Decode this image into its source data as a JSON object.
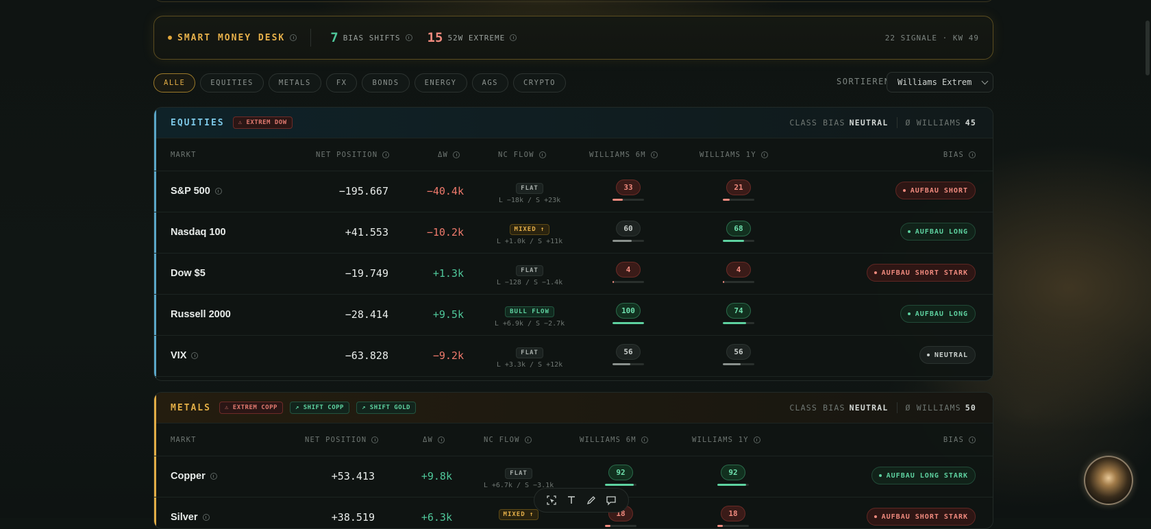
{
  "header": {
    "title": "SMART MONEY DESK",
    "stats": [
      {
        "value": "7",
        "label": "BIAS SHIFTS",
        "color": "#4fc79a"
      },
      {
        "value": "15",
        "label": "52W EXTREME",
        "color": "#f08a7e"
      }
    ],
    "meta": "22 SIGNALE · KW 49"
  },
  "filters": [
    "ALLE",
    "EQUITIES",
    "METALS",
    "FX",
    "BONDS",
    "ENERGY",
    "AGS",
    "CRYPTO"
  ],
  "active_filter": "ALLE",
  "sort": {
    "label": "SORTIEREN",
    "value": "Williams Extrem"
  },
  "columns": {
    "market": "MARKT",
    "net": "NET POSITION",
    "dw": "ΔW",
    "flow": "NC FLOW",
    "w6m": "WILLIAMS 6M",
    "w1y": "WILLIAMS 1Y",
    "bias": "BIAS"
  },
  "sections": [
    {
      "title": "EQUITIES",
      "accent": "#5aa6c8",
      "tags": [
        {
          "text": "⚠ EXTREM DOW",
          "kind": "red"
        }
      ],
      "class_bias_label": "CLASS BIAS",
      "class_bias": "NEUTRAL",
      "williams_label": "Ø WILLIAMS",
      "williams": "45",
      "rows": [
        {
          "name": "S&P 500",
          "info": true,
          "net": "−195.667",
          "dw": "−40.4k",
          "dw_dir": "neg",
          "flow": "FLAT",
          "flow_kind": "flat",
          "flow_sub": "L −18k / S +23k",
          "w6m": "33",
          "w6m_kind": "red",
          "w6m_pct": 33,
          "w1y": "21",
          "w1y_kind": "red",
          "w1y_pct": 21,
          "bias": "AUFBAU SHORT",
          "bias_kind": "short"
        },
        {
          "name": "Nasdaq 100",
          "info": false,
          "net": "+41.553",
          "dw": "−10.2k",
          "dw_dir": "neg",
          "flow": "MIXED ↑",
          "flow_kind": "mixed",
          "flow_sub": "L +1.0k / S +11k",
          "w6m": "60",
          "w6m_kind": "gray",
          "w6m_pct": 60,
          "w1y": "68",
          "w1y_kind": "green",
          "w1y_pct": 68,
          "bias": "AUFBAU LONG",
          "bias_kind": "long"
        },
        {
          "name": "Dow $5",
          "info": false,
          "net": "−19.749",
          "dw": "+1.3k",
          "dw_dir": "pos",
          "flow": "FLAT",
          "flow_kind": "flat",
          "flow_sub": "L −128 / S −1.4k",
          "w6m": "4",
          "w6m_kind": "red",
          "w6m_pct": 4,
          "w1y": "4",
          "w1y_kind": "red",
          "w1y_pct": 4,
          "bias": "AUFBAU SHORT STARK",
          "bias_kind": "short"
        },
        {
          "name": "Russell 2000",
          "info": false,
          "net": "−28.414",
          "dw": "+9.5k",
          "dw_dir": "pos",
          "flow": "BULL FLOW",
          "flow_kind": "bull",
          "flow_sub": "L +6.9k / S −2.7k",
          "w6m": "100",
          "w6m_kind": "green",
          "w6m_pct": 100,
          "w1y": "74",
          "w1y_kind": "green",
          "w1y_pct": 74,
          "bias": "AUFBAU LONG",
          "bias_kind": "long"
        },
        {
          "name": "VIX",
          "info": true,
          "net": "−63.828",
          "dw": "−9.2k",
          "dw_dir": "neg",
          "flow": "FLAT",
          "flow_kind": "flat",
          "flow_sub": "L +3.3k / S +12k",
          "w6m": "56",
          "w6m_kind": "gray",
          "w6m_pct": 56,
          "w1y": "56",
          "w1y_kind": "gray",
          "w1y_pct": 56,
          "bias": "NEUTRAL",
          "bias_kind": "neutral"
        }
      ]
    },
    {
      "title": "METALS",
      "accent": "#e2ad45",
      "tags": [
        {
          "text": "⚠ EXTREM COPP",
          "kind": "red"
        },
        {
          "text": "↗ SHIFT COPP",
          "kind": "green"
        },
        {
          "text": "↗ SHIFT GOLD",
          "kind": "green"
        }
      ],
      "class_bias_label": "CLASS BIAS",
      "class_bias": "NEUTRAL",
      "williams_label": "Ø WILLIAMS",
      "williams": "50",
      "rows": [
        {
          "name": "Copper",
          "info": true,
          "net": "+53.413",
          "dw": "+9.8k",
          "dw_dir": "pos",
          "flow": "FLAT",
          "flow_kind": "flat",
          "flow_sub": "L +6.7k / S −3.1k",
          "w6m": "92",
          "w6m_kind": "green",
          "w6m_pct": 92,
          "w1y": "92",
          "w1y_kind": "green",
          "w1y_pct": 92,
          "bias": "AUFBAU LONG STARK",
          "bias_kind": "long"
        },
        {
          "name": "Silver",
          "info": true,
          "net": "+38.519",
          "dw": "+6.3k",
          "dw_dir": "pos",
          "flow": "MIXED ↑",
          "flow_kind": "mixed",
          "flow_sub": "",
          "w6m": "18",
          "w6m_kind": "red",
          "w6m_pct": 18,
          "w1y": "18",
          "w1y_kind": "red",
          "w1y_pct": 18,
          "bias": "AUFBAU SHORT STARK",
          "bias_kind": "short"
        }
      ]
    }
  ],
  "toolbar": [
    "select-icon",
    "text-icon",
    "pen-icon",
    "comment-icon"
  ],
  "colors": {
    "pos": "#4fc79a",
    "neg": "#ef7a6c",
    "gold": "#e2ad45"
  }
}
